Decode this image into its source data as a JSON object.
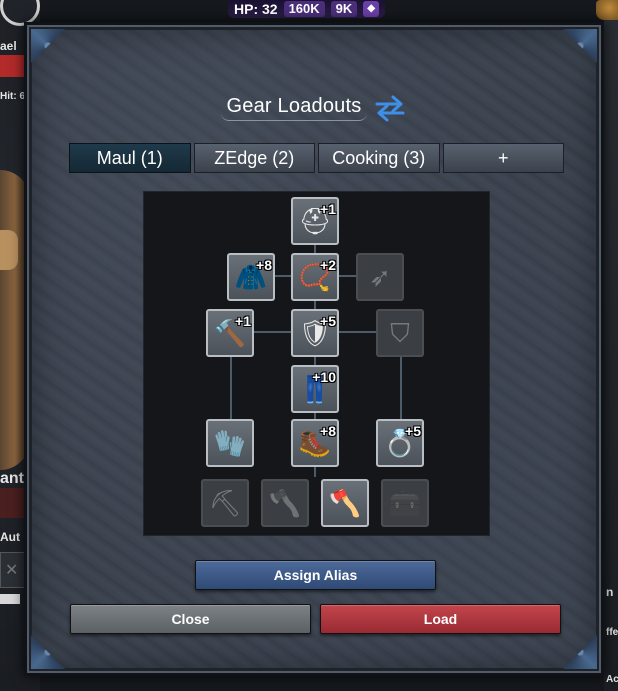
{
  "background": {
    "hud": {
      "hp_label": "HP: 32",
      "stat_a": "160K",
      "stat_b": "9K"
    },
    "left_texts": {
      "name_fragment": "ael",
      "hit_fragment": "Hit: 6",
      "ant_fragment": "ant",
      "aut_fragment": "Aut"
    },
    "right_texts": {
      "n_fragment": "n",
      "ffe_fragment": "ffe",
      "ac_fragment": "Ac"
    }
  },
  "modal": {
    "title": "Gear Loadouts",
    "swap_icon": "swap-arrows-icon",
    "tabs": [
      {
        "label": "Maul (1)",
        "active": true
      },
      {
        "label": "ZEdge (2)",
        "active": false
      },
      {
        "label": "Cooking (3)",
        "active": false
      },
      {
        "label": "+",
        "active": false
      }
    ],
    "slots": {
      "helm": {
        "icon": "helmet-icon",
        "level": "+1",
        "filled": true
      },
      "cape": {
        "icon": "cape-icon",
        "level": "+8",
        "filled": true
      },
      "amulet": {
        "icon": "amulet-icon",
        "level": "+2",
        "filled": true
      },
      "arrows": {
        "icon": "arrows-icon",
        "level": "",
        "filled": false
      },
      "weapon": {
        "icon": "maul-icon",
        "level": "+1",
        "filled": true
      },
      "body": {
        "icon": "body-armor-icon",
        "level": "+5",
        "filled": true
      },
      "shield": {
        "icon": "shield-icon",
        "level": "",
        "filled": false
      },
      "legs": {
        "icon": "leg-armor-icon",
        "level": "+10",
        "filled": true
      },
      "gloves": {
        "icon": "gloves-icon",
        "level": "",
        "filled": true
      },
      "boots": {
        "icon": "boots-icon",
        "level": "+8",
        "filled": true
      },
      "ring": {
        "icon": "ring-icon",
        "level": "+5",
        "filled": true
      }
    },
    "tools": [
      {
        "icon": "pickaxe-icon",
        "filled": false
      },
      {
        "icon": "hatchet-icon",
        "filled": false
      },
      {
        "icon": "axe-icon",
        "filled": true
      },
      {
        "icon": "tackle-box-icon",
        "filled": false
      }
    ],
    "buttons": {
      "assign_alias": "Assign Alias",
      "close": "Close",
      "load": "Load"
    }
  },
  "colors": {
    "active_tab": "#1f3a4a",
    "assign_button": "#3b5a8a",
    "close_button": "#6b7074",
    "load_button": "#b3363f",
    "swap_icon": "#3d8fe8"
  }
}
